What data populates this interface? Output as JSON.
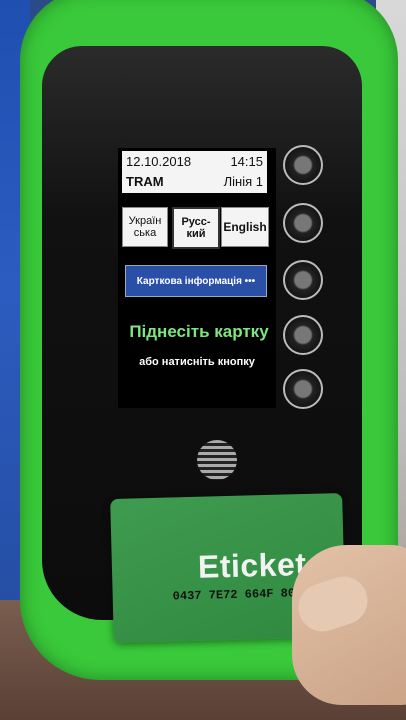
{
  "screen": {
    "date": "12.10.2018",
    "time": "14:15",
    "vehicle": "TRAM",
    "line": "Лінія 1"
  },
  "languages": {
    "ukrainian": "Україн\nська",
    "russian": "Русс-\nкий",
    "english": "English"
  },
  "card_info_button": "Карткова інформація •••",
  "prompt": {
    "main": "Піднесіть картку",
    "sub": "або натисніть кнопку"
  },
  "card": {
    "brand": "Eticket",
    "number": "0437 7E72 664F 80"
  },
  "colors": {
    "device_body": "#39c93a",
    "prompt_text": "#7ee67e",
    "card_info_bg": "#2a4fa7"
  }
}
